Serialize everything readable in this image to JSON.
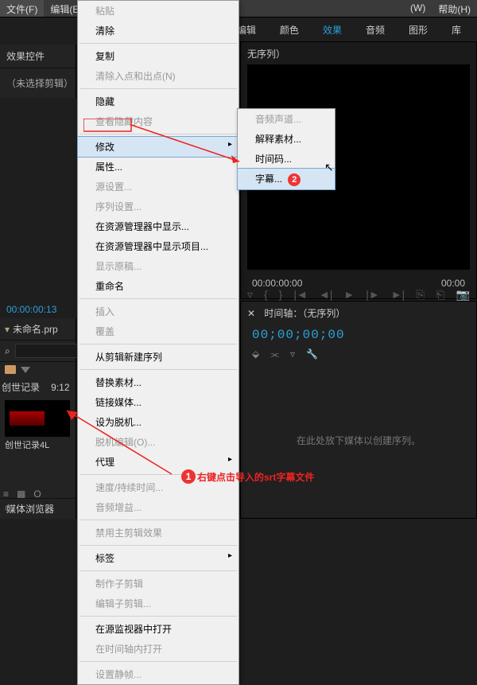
{
  "menubar": {
    "file": "文件(F)",
    "edit": "编辑(E)",
    "window": "(W)",
    "help": "帮助(H)"
  },
  "tabs": {
    "edit": "编辑",
    "color": "颜色",
    "effects": "效果",
    "audio": "音频",
    "graphics": "图形",
    "library": "库"
  },
  "effects_panel": {
    "title": "效果控件",
    "empty": "（未选择剪辑）"
  },
  "source_panel": {
    "title": "无序列）",
    "time_left": "00:00:00:00",
    "time_right": "00:00"
  },
  "timecode_top": "00:00:00:13",
  "project": {
    "tab": "未命名.prp",
    "bin": "创世记录",
    "bin_dur": "9:12",
    "item": "创世记录4L",
    "browser": "媒体浏览器"
  },
  "search_placeholder": "",
  "timeline": {
    "title": "时间轴：（无序列）",
    "tc": "00;00;00;00",
    "empty": "在此处放下媒体以创建序列。"
  },
  "ctx": {
    "paste": "粘贴",
    "clear": "清除",
    "copy": "复制",
    "inout": "清除入点和出点(N)",
    "hide": "隐藏",
    "viewhidden": "查看隐藏内容",
    "modify": "修改",
    "props": "属性...",
    "srcset": "源设置...",
    "seqset": "序列设置...",
    "reveal": "在资源管理器中显示...",
    "revealproj": "在资源管理器中显示项目...",
    "showorig": "显示原稿...",
    "rename": "重命名",
    "insert": "插入",
    "overwrite": "覆盖",
    "newseq": "从剪辑新建序列",
    "replace": "替换素材...",
    "link": "链接媒体...",
    "offline": "设为脱机...",
    "offedit": "脱机编辑(O)...",
    "proxy": "代理",
    "speed": "速度/持续时间...",
    "gain": "音频增益...",
    "disable": "禁用主剪辑效果",
    "label": "标签",
    "makesub": "制作子剪辑",
    "editsub": "编辑子剪辑...",
    "opensrc": "在源监视器中打开",
    "opentl": "在时间轴内打开",
    "setposter": "设置静帧..."
  },
  "sub": {
    "audch": "音频声道...",
    "interpret": "解释素材...",
    "tc": "时间码...",
    "subtitle": "字幕..."
  },
  "annot": {
    "text": "右键点击导入的srt字幕文件"
  },
  "icons": {
    "search": "⌕",
    "list": "≡",
    "grid": "▦",
    "sort": "O",
    "play": "►",
    "step_back": "◄|",
    "step_fwd": "|►",
    "begin": "|◄",
    "end": "►|",
    "cam": "📷",
    "wrench": "🔧",
    "snap": "⬙",
    "link": "⫘",
    "marker": "▿",
    "chevron": "▾",
    "close": "✕",
    "sync": "⟳"
  }
}
